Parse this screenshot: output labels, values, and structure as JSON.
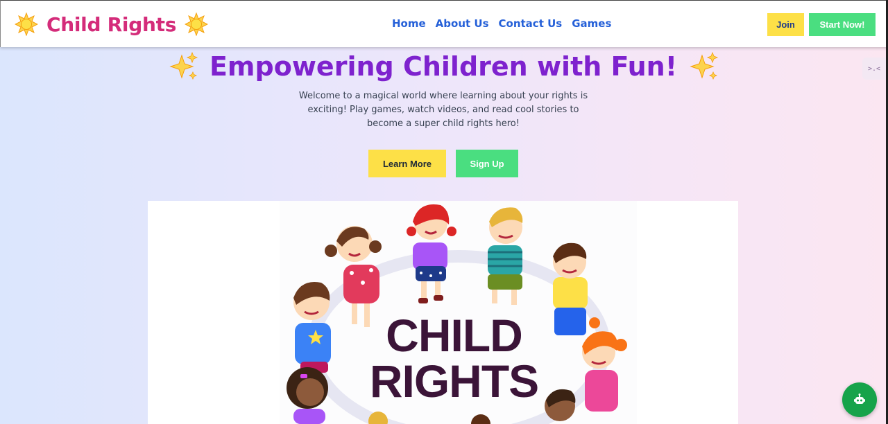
{
  "header": {
    "brand": "Child Rights",
    "nav": [
      "Home",
      "About Us",
      "Contact Us",
      "Games"
    ],
    "join_label": "Join",
    "start_label": "Start Now!"
  },
  "hero": {
    "title": "Empowering Children with Fun!",
    "description": "Welcome to a magical world where learning about your rights is exciting! Play games, watch videos, and read cool stories to become a super child rights hero!",
    "learn_more_label": "Learn More",
    "sign_up_label": "Sign Up"
  },
  "illustration": {
    "title_line1": "CHILD",
    "title_line2": "RIGHTS"
  },
  "side_tab": {
    "text": ">.<"
  },
  "colors": {
    "brand": "#d42c7a",
    "nav_link": "#2560d8",
    "title": "#7e22ce",
    "yellow_button": "#fde047",
    "green_button": "#4ade80",
    "chat_button": "#16a34a"
  },
  "icons": {
    "brand_left": "sun-icon",
    "brand_right": "sun-icon",
    "title_left": "sparkles-icon",
    "title_right": "sparkles-icon",
    "chat": "robot-icon"
  }
}
